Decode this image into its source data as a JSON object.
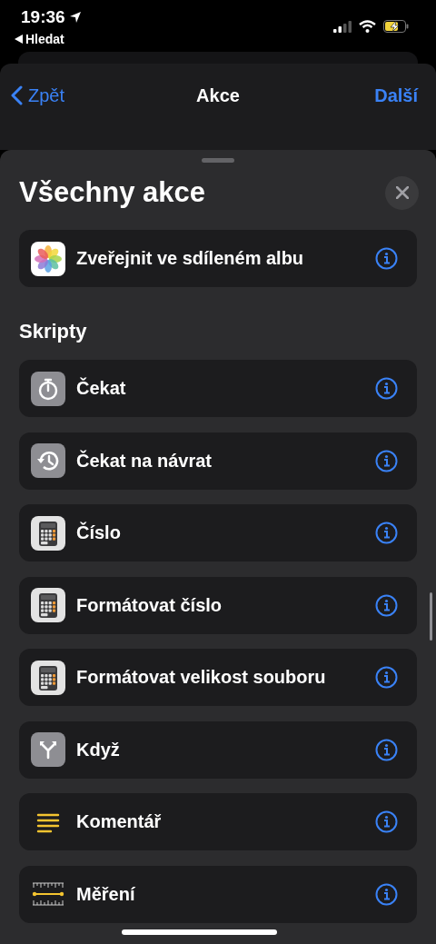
{
  "status_bar": {
    "time": "19:36",
    "back_app": "Hledat"
  },
  "nav": {
    "back": "Zpět",
    "title": "Akce",
    "next": "Další"
  },
  "sheet": {
    "title": "Všechny akce",
    "actions": [
      {
        "label": "Zveřejnit ve sdíleném albu",
        "kind": "photos"
      }
    ],
    "sections": [
      {
        "title": "Skripty",
        "actions": [
          {
            "label": "Čekat",
            "kind": "stopwatch"
          },
          {
            "label": "Čekat na návrat",
            "kind": "history"
          },
          {
            "label": "Číslo",
            "kind": "calculator"
          },
          {
            "label": "Formátovat číslo",
            "kind": "calculator"
          },
          {
            "label": "Formátovat velikost souboru",
            "kind": "calculator"
          },
          {
            "label": "Když",
            "kind": "branch"
          },
          {
            "label": "Komentář",
            "kind": "comment"
          },
          {
            "label": "Měření",
            "kind": "ruler"
          }
        ]
      }
    ]
  }
}
